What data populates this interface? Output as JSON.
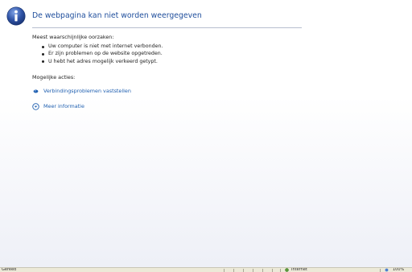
{
  "page": {
    "title": "De webpagina kan niet worden weergegeven",
    "causes_heading": "Meest waarschijnlijke oorzaken:",
    "causes": [
      "Uw computer is niet met internet verbonden.",
      "Er zijn problemen op de website opgetreden.",
      "U hebt het adres mogelijk verkeerd getypt."
    ],
    "actions_heading": "Mogelijke acties:",
    "actions": [
      {
        "label": "Verbindingsproblemen vaststellen",
        "icon": "diagnose-icon"
      },
      {
        "label": "Meer informatie",
        "icon": "expand-icon"
      }
    ]
  },
  "statusbar": {
    "status": "Gereed",
    "zone": "Internet",
    "zoom": "100%"
  },
  "colors": {
    "title": "#1f4e9c",
    "link": "#1f5fb0",
    "info_icon": "#2f53a6"
  }
}
